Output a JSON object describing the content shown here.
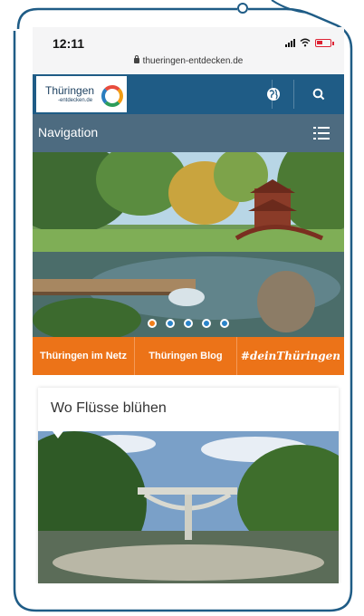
{
  "status_bar": {
    "time": "12:11",
    "url": "thueringen-entdecken.de"
  },
  "header": {
    "logo_text": "Thüringen",
    "logo_subtext": "-entdecken.de",
    "globe_icon": "globe-icon",
    "search_icon": "search-icon"
  },
  "navigation": {
    "label": "Navigation",
    "menu_icon": "menu-list-icon"
  },
  "hero_slider": {
    "dot_count": 5,
    "active_index": 0
  },
  "quick_links": [
    {
      "label": "Thüringen im Netz"
    },
    {
      "label": "Thüringen Blog"
    },
    {
      "label": "#deinThüringen"
    }
  ],
  "article_card": {
    "title": "Wo Flüsse blühen"
  },
  "colors": {
    "header_blue": "#1f5c86",
    "nav_slate": "#4d6b80",
    "orange": "#ec7318",
    "dot_blue": "#2a84c9"
  }
}
